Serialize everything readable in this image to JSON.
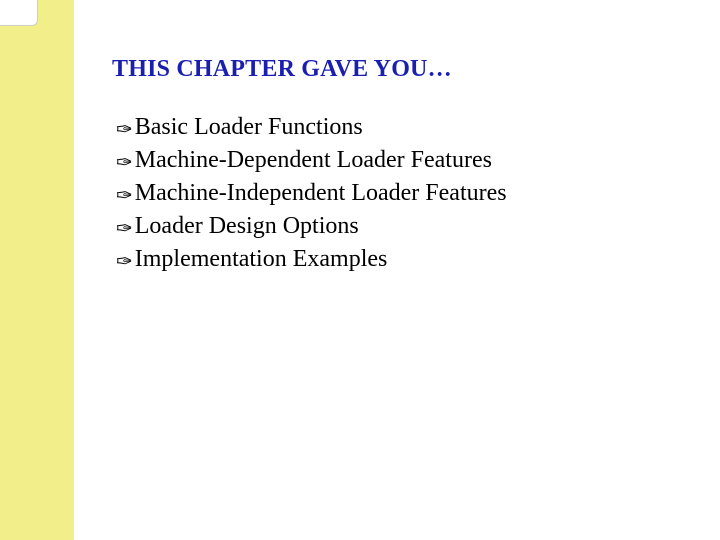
{
  "slide": {
    "title": "THIS CHAPTER GAVE YOU…",
    "items": [
      {
        "text": "Basic Loader Functions"
      },
      {
        "text": "Machine-Dependent Loader Features"
      },
      {
        "text": "Machine-Independent Loader Features"
      },
      {
        "text": "Loader Design Options"
      },
      {
        "text": "Implementation Examples"
      }
    ]
  }
}
